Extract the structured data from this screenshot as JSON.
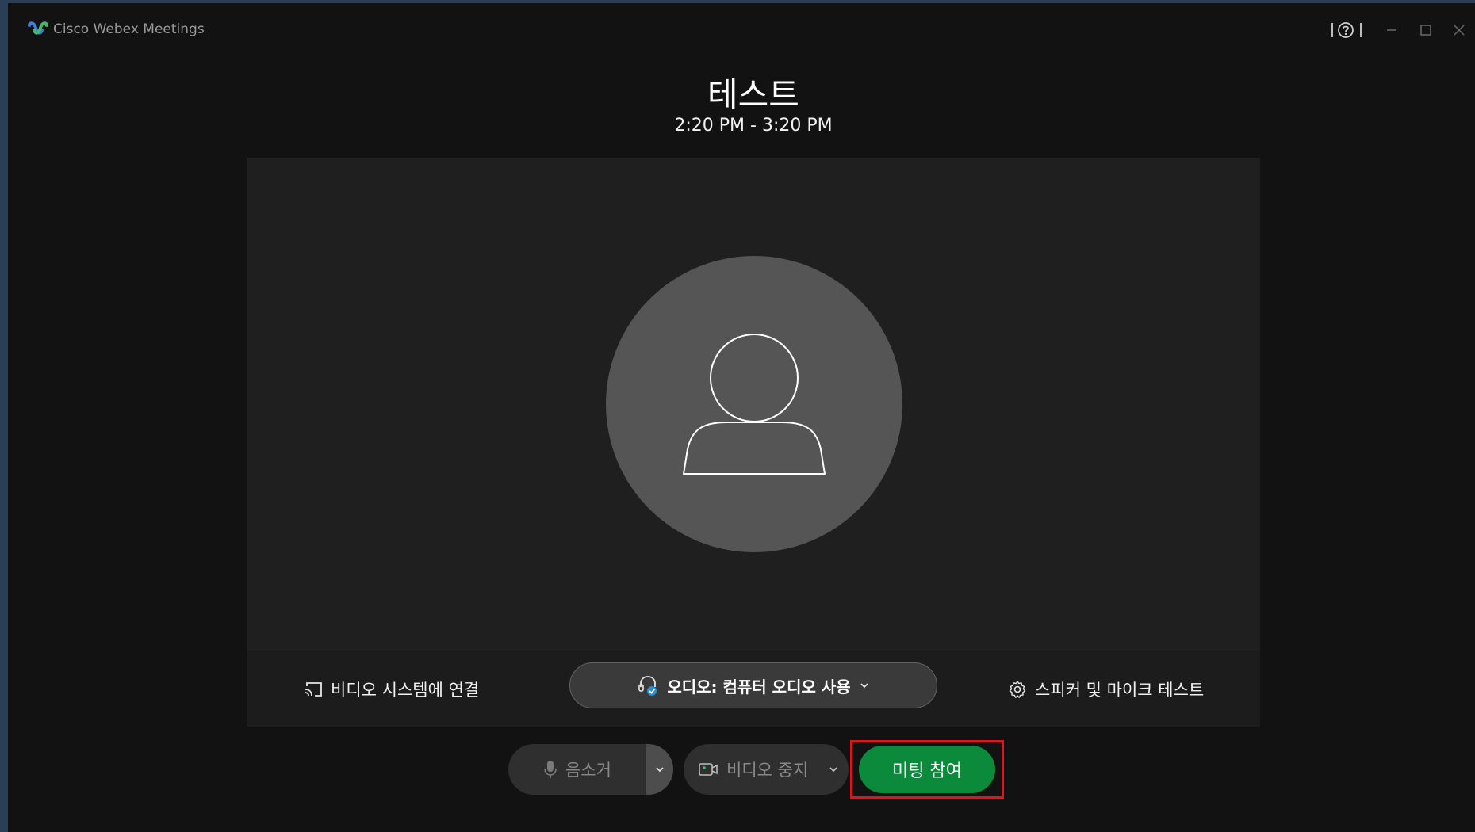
{
  "window": {
    "app_title": "Cisco Webex Meetings"
  },
  "meeting": {
    "title": "테스트",
    "time": "2:20 PM - 3:20 PM"
  },
  "preview": {
    "connect_video_system_label": "비디오 시스템에 연결",
    "audio_label": "오디오: 컴퓨터 오디오 사용",
    "speaker_mic_test_label": "스피커 및 마이크 테스트"
  },
  "controls": {
    "mute_label": "음소거",
    "stop_video_label": "비디오 중지",
    "join_label": "미팅 참여"
  },
  "colors": {
    "join_button": "#0c8a3c",
    "highlight_border": "#e2141b",
    "audio_check_badge": "#2a8fd6"
  }
}
